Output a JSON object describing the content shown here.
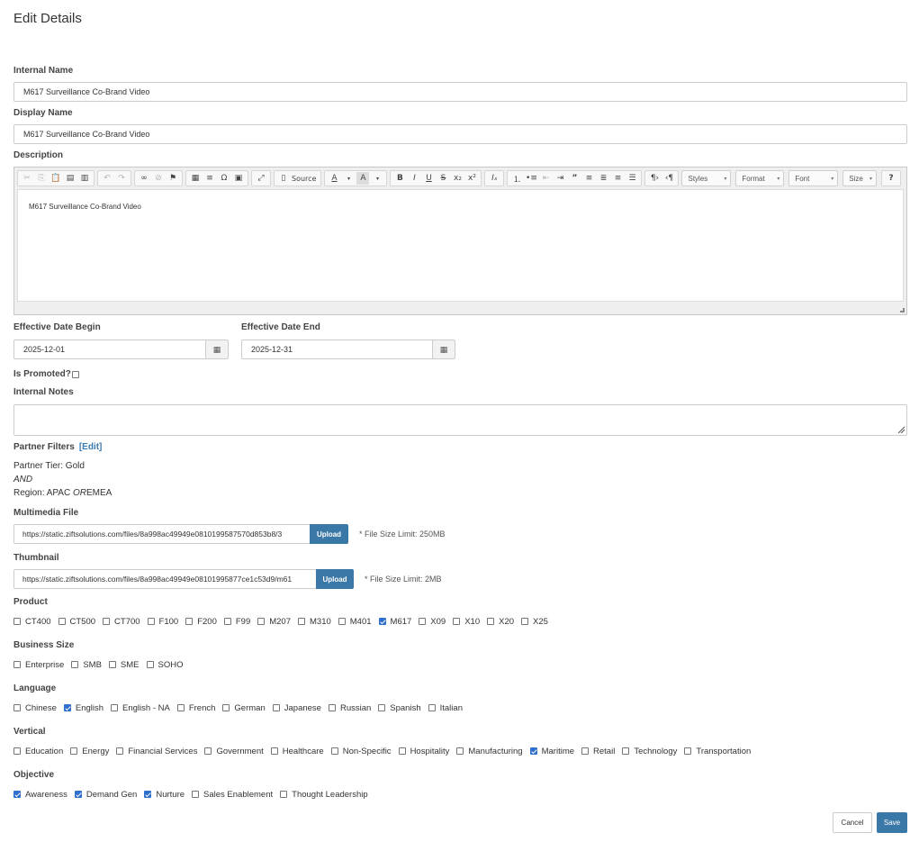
{
  "page": {
    "title": "Edit Details"
  },
  "internal_name": {
    "label": "Internal Name",
    "value": "M617 Surveillance Co-Brand Video"
  },
  "display_name": {
    "label": "Display Name",
    "value": "M617 Surveillance Co-Brand Video"
  },
  "description": {
    "label": "Description",
    "content": "M617 Surveillance Co-Brand Video",
    "toolbar": {
      "source_label": "Source",
      "styles_label": "Styles",
      "format_label": "Format",
      "font_label": "Font",
      "size_label": "Size"
    }
  },
  "effective_date_begin": {
    "label": "Effective Date Begin",
    "value": "2025-12-01"
  },
  "effective_date_end": {
    "label": "Effective Date End",
    "value": "2025-12-31"
  },
  "is_promoted": {
    "label": "Is Promoted?",
    "checked": false
  },
  "internal_notes": {
    "label": "Internal Notes",
    "value": ""
  },
  "partner_filters": {
    "label": "Partner Filters",
    "edit_label": "[Edit]",
    "tier_line": "Partner Tier: Gold",
    "and_label": "AND",
    "region_prefix": "Region: APAC ",
    "or_label": "OR",
    "region_suffix": "EMEA"
  },
  "multimedia": {
    "label": "Multimedia File",
    "value": "https://static.ziftsolutions.com/files/8a998ac49949e0810199587570d853b8/3",
    "upload_label": "Upload",
    "note": "* File Size Limit: 250MB"
  },
  "thumbnail": {
    "label": "Thumbnail",
    "value": "https://static.ziftsolutions.com/files/8a998ac49949e08101995877ce1c53d9/m61",
    "upload_label": "Upload",
    "note": "* File Size Limit: 2MB"
  },
  "product": {
    "label": "Product",
    "options": [
      {
        "label": "CT400",
        "checked": false
      },
      {
        "label": "CT500",
        "checked": false
      },
      {
        "label": "CT700",
        "checked": false
      },
      {
        "label": "F100",
        "checked": false
      },
      {
        "label": "F200",
        "checked": false
      },
      {
        "label": "F99",
        "checked": false
      },
      {
        "label": "M207",
        "checked": false
      },
      {
        "label": "M310",
        "checked": false
      },
      {
        "label": "M401",
        "checked": false
      },
      {
        "label": "M617",
        "checked": true
      },
      {
        "label": "X09",
        "checked": false
      },
      {
        "label": "X10",
        "checked": false
      },
      {
        "label": "X20",
        "checked": false
      },
      {
        "label": "X25",
        "checked": false
      }
    ]
  },
  "business_size": {
    "label": "Business Size",
    "options": [
      {
        "label": "Enterprise",
        "checked": false
      },
      {
        "label": "SMB",
        "checked": false
      },
      {
        "label": "SME",
        "checked": false
      },
      {
        "label": "SOHO",
        "checked": false
      }
    ]
  },
  "language": {
    "label": "Language",
    "options": [
      {
        "label": "Chinese",
        "checked": false
      },
      {
        "label": "English",
        "checked": true
      },
      {
        "label": "English - NA",
        "checked": false
      },
      {
        "label": "French",
        "checked": false
      },
      {
        "label": "German",
        "checked": false
      },
      {
        "label": "Japanese",
        "checked": false
      },
      {
        "label": "Russian",
        "checked": false
      },
      {
        "label": "Spanish",
        "checked": false
      },
      {
        "label": "Italian",
        "checked": false
      }
    ]
  },
  "vertical": {
    "label": "Vertical",
    "options": [
      {
        "label": "Education",
        "checked": false
      },
      {
        "label": "Energy",
        "checked": false
      },
      {
        "label": "Financial Services",
        "checked": false
      },
      {
        "label": "Government",
        "checked": false
      },
      {
        "label": "Healthcare",
        "checked": false
      },
      {
        "label": "Non-Specific",
        "checked": false
      },
      {
        "label": "Hospitality",
        "checked": false
      },
      {
        "label": "Manufacturing",
        "checked": false
      },
      {
        "label": "Maritime",
        "checked": true
      },
      {
        "label": "Retail",
        "checked": false
      },
      {
        "label": "Technology",
        "checked": false
      },
      {
        "label": "Transportation",
        "checked": false
      }
    ]
  },
  "objective": {
    "label": "Objective",
    "options": [
      {
        "label": "Awareness",
        "checked": true
      },
      {
        "label": "Demand Gen",
        "checked": true
      },
      {
        "label": "Nurture",
        "checked": true
      },
      {
        "label": "Sales Enablement",
        "checked": false
      },
      {
        "label": "Thought Leadership",
        "checked": false
      }
    ]
  },
  "actions": {
    "cancel_label": "Cancel",
    "save_label": "Save"
  },
  "colors": {
    "primary": "#3a78a8",
    "link": "#3a7bb0",
    "checkbox_checked": "#2f6fce"
  }
}
